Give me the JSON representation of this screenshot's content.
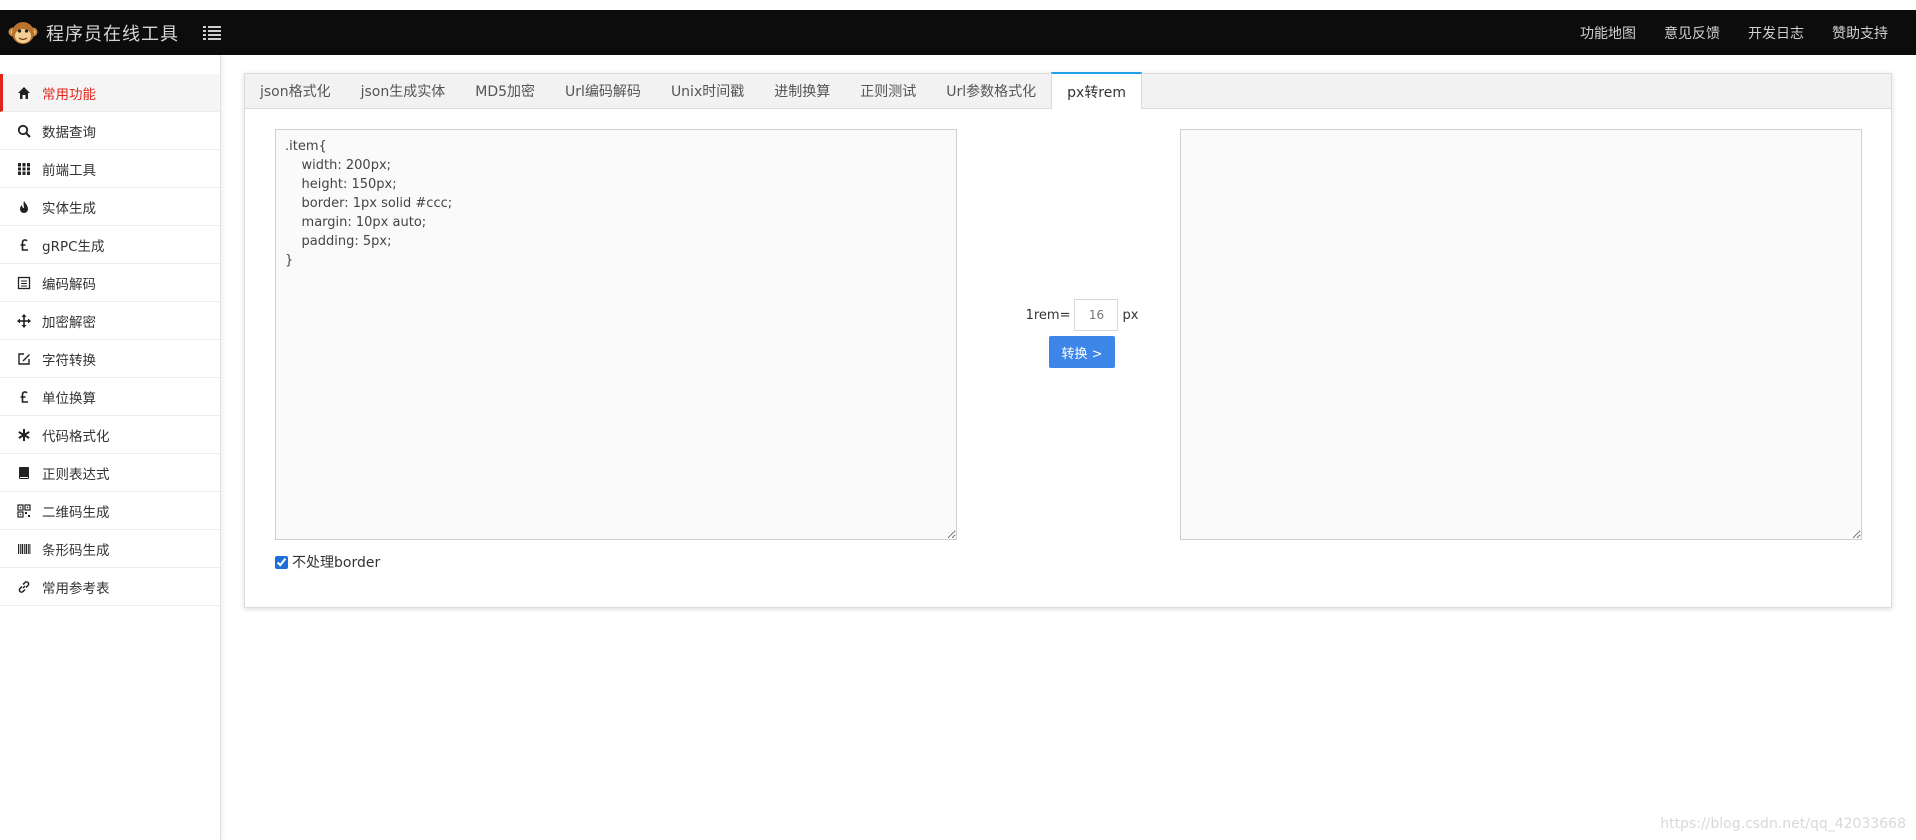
{
  "app": {
    "title": "程序员在线工具"
  },
  "nav": {
    "links": [
      "功能地图",
      "意见反馈",
      "开发日志",
      "赞助支持"
    ]
  },
  "sidebar": {
    "items": [
      {
        "label": "常用功能",
        "icon": "home-icon",
        "active": true
      },
      {
        "label": "数据查询",
        "icon": "search-icon"
      },
      {
        "label": "前端工具",
        "icon": "grid-icon"
      },
      {
        "label": "实体生成",
        "icon": "fire-icon"
      },
      {
        "label": "gRPC生成",
        "icon": "pound-icon"
      },
      {
        "label": "编码解码",
        "icon": "list-icon"
      },
      {
        "label": "加密解密",
        "icon": "move-icon"
      },
      {
        "label": "字符转换",
        "icon": "edit-icon"
      },
      {
        "label": "单位换算",
        "icon": "pound-icon"
      },
      {
        "label": "代码格式化",
        "icon": "asterisk-icon"
      },
      {
        "label": "正则表达式",
        "icon": "book-icon"
      },
      {
        "label": "二维码生成",
        "icon": "qrcode-icon"
      },
      {
        "label": "条形码生成",
        "icon": "barcode-icon"
      },
      {
        "label": "常用参考表",
        "icon": "link-icon"
      }
    ]
  },
  "tabs": [
    {
      "label": "json格式化"
    },
    {
      "label": "json生成实体"
    },
    {
      "label": "MD5加密"
    },
    {
      "label": "Url编码解码"
    },
    {
      "label": "Unix时间戳"
    },
    {
      "label": "进制换算"
    },
    {
      "label": "正则测试"
    },
    {
      "label": "Url参数格式化"
    },
    {
      "label": "px转rem",
      "active": true
    }
  ],
  "converter": {
    "input_value": ".item{\n    width: 200px;\n    height: 150px;\n    border: 1px solid #ccc;\n    margin: 10px auto;\n    padding: 5px;\n}",
    "output_value": "",
    "rem_prefix": "1rem=",
    "rem_placeholder": "16",
    "rem_suffix": "px",
    "button_label": "转换 >",
    "skip_border_label": "不处理border",
    "skip_border_checked": true
  },
  "watermark": "https://blog.csdn.net/qq_42033668",
  "colors": {
    "navbar_bg": "#0c0c0c",
    "active_item": "#e1251b",
    "active_tab_border": "#23a0e8",
    "button_bg": "#3d86e8"
  }
}
